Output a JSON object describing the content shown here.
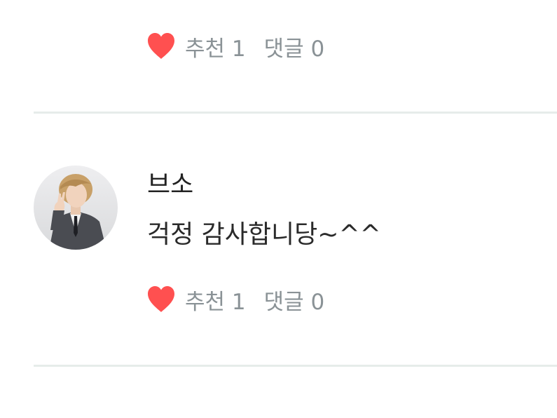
{
  "colors": {
    "heart": "#ff5050",
    "meta_text": "#8a9296",
    "divider": "#e6ecea"
  },
  "previous_comment": {
    "like_label": "추천 1",
    "reply_label": "댓글 0"
  },
  "comment": {
    "author": "브소",
    "text": "걱정 감사합니당~^^",
    "like_label": "추천 1",
    "reply_label": "댓글 0"
  }
}
